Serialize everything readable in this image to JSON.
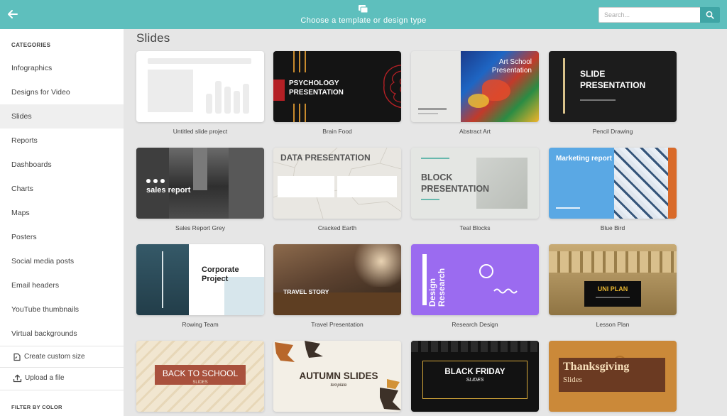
{
  "topbar": {
    "title": "Choose a template or design type",
    "search_placeholder": "Search..."
  },
  "sidebar": {
    "categories_heading": "CATEGORIES",
    "items": [
      {
        "label": "Infographics"
      },
      {
        "label": "Designs for Video"
      },
      {
        "label": "Slides",
        "active": true
      },
      {
        "label": "Reports"
      },
      {
        "label": "Dashboards"
      },
      {
        "label": "Charts"
      },
      {
        "label": "Maps"
      },
      {
        "label": "Posters"
      },
      {
        "label": "Social media posts"
      },
      {
        "label": "Email headers"
      },
      {
        "label": "YouTube thumbnails"
      },
      {
        "label": "Virtual backgrounds"
      }
    ],
    "create_custom_size": "Create custom size",
    "upload_file": "Upload a file",
    "filter_heading": "FILTER BY COLOR"
  },
  "main": {
    "section_title": "Slides",
    "templates": [
      {
        "name": "Untitled slide project"
      },
      {
        "name": "Brain Food",
        "title": "PSYCHOLOGY PRESENTATION"
      },
      {
        "name": "Abstract Art",
        "title": "Art School Presentation"
      },
      {
        "name": "Pencil Drawing",
        "title": "SLIDE PRESENTATION"
      },
      {
        "name": "Sales Report Grey",
        "title": "sales report"
      },
      {
        "name": "Cracked Earth",
        "title": "DATA PRESENTATION"
      },
      {
        "name": "Teal Blocks",
        "title": "BLOCK PRESENTATION"
      },
      {
        "name": "Blue Bird",
        "title": "Marketing report"
      },
      {
        "name": "Rowing Team",
        "title": "Corporate Project"
      },
      {
        "name": "Travel Presentation",
        "title": "TRAVEL STORY"
      },
      {
        "name": "Research Design",
        "title": "Design Research"
      },
      {
        "name": "Lesson Plan",
        "title": "UNI PLAN"
      },
      {
        "name": "Back to School",
        "title": "BACK TO SCHOOL",
        "subtitle": "SLIDES"
      },
      {
        "name": "Autumn Slides",
        "title": "AUTUMN SLIDES",
        "subtitle": "template"
      },
      {
        "name": "Black Friday",
        "title": "BLACK FRIDAY",
        "subtitle": "SLIDES"
      },
      {
        "name": "Thanksgiving",
        "title": "Thanksgiving",
        "subtitle": "Slides"
      }
    ]
  },
  "colors": {
    "topbar": "#5ebfbd",
    "search_button": "#3fa5a5",
    "sidebar_active": "#efefef",
    "background": "#e6e6e6"
  }
}
